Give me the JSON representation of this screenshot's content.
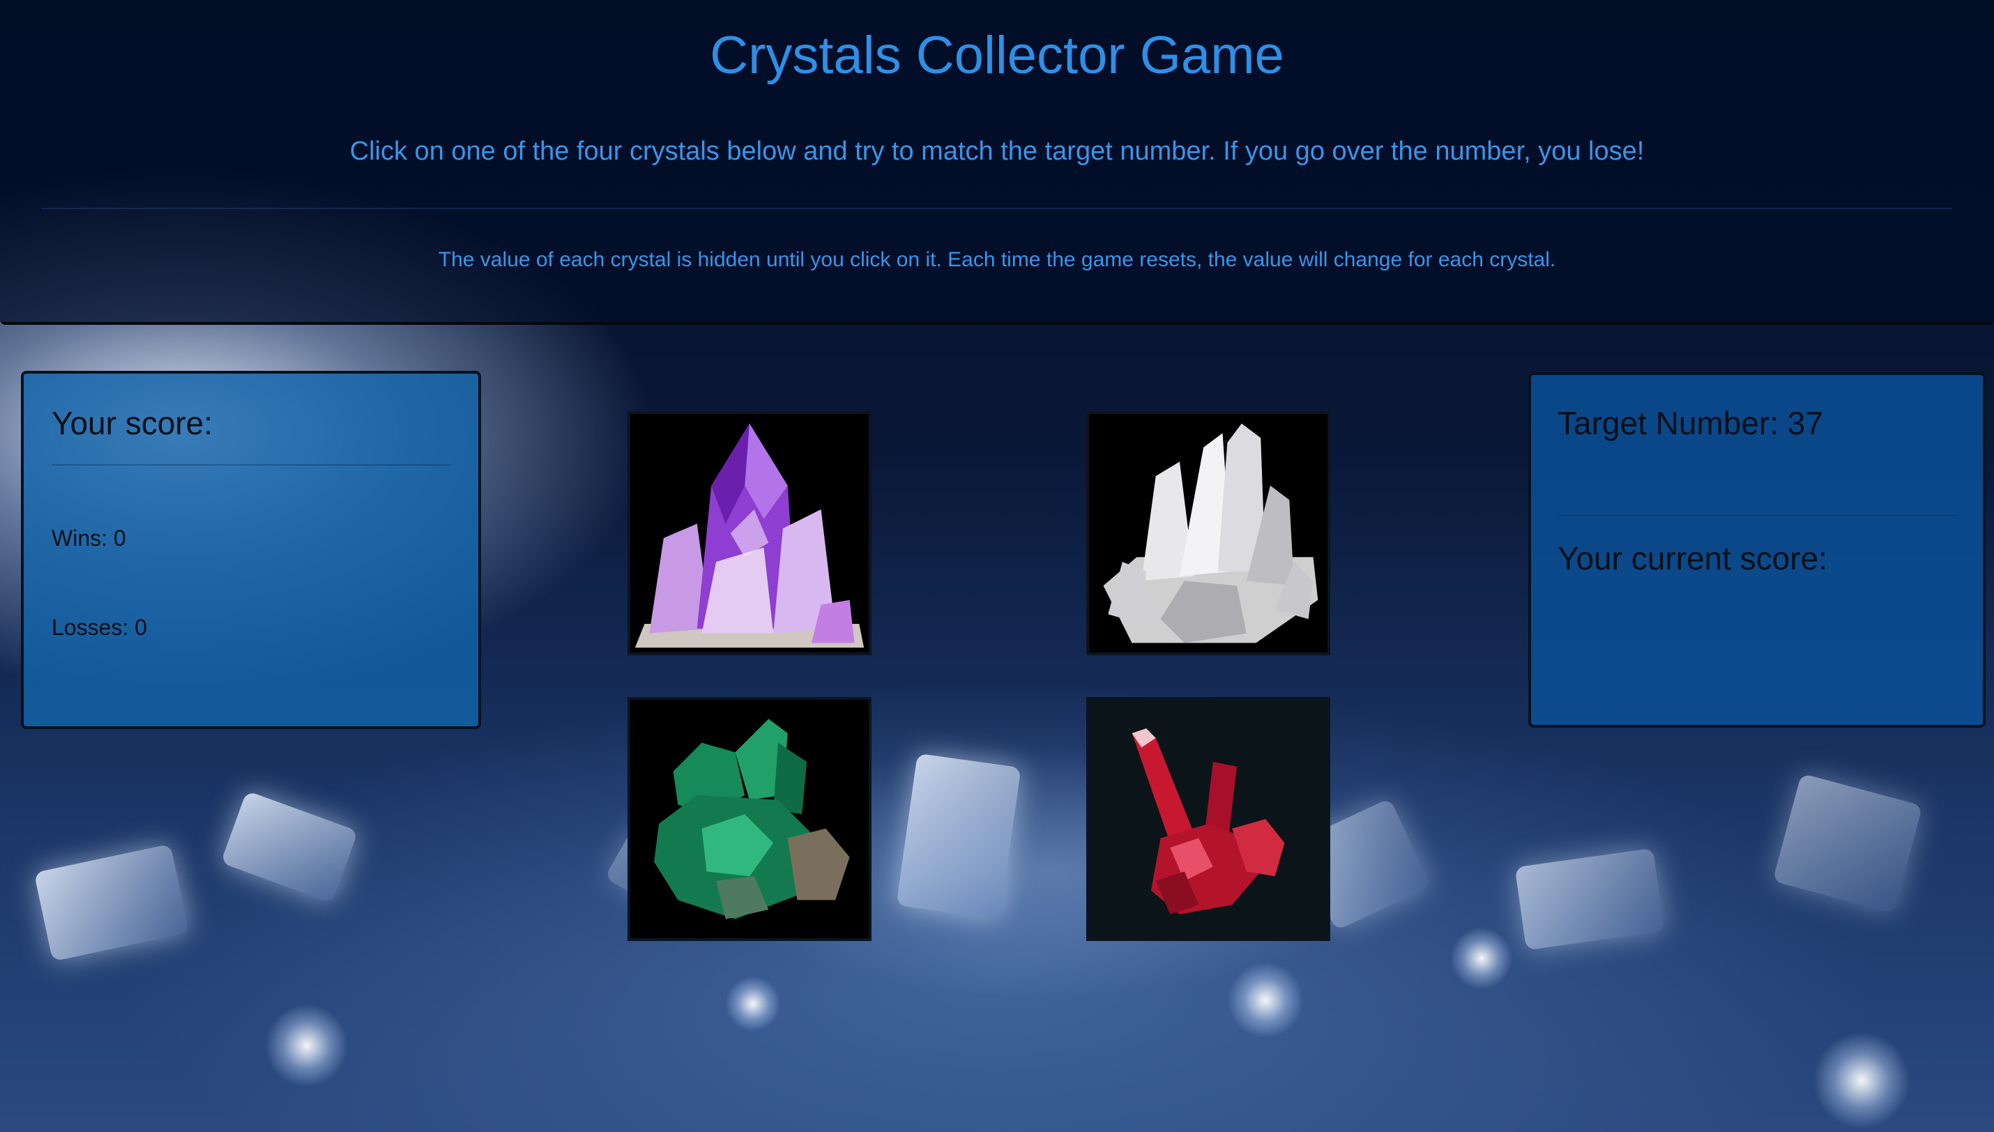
{
  "header": {
    "title": "Crystals Collector Game",
    "instructions": "Click on one of the four crystals below and try to match the target number. If you go over the number, you lose!",
    "note": "The value of each crystal is hidden until you click on it. Each time the game resets, the value will change for each crystal."
  },
  "score_panel": {
    "heading": "Your score:",
    "wins": "Wins: 0",
    "losses": "Losses: 0"
  },
  "target_panel": {
    "target": "Target Number: 37",
    "current_score_label": "Your current score:"
  },
  "crystals": [
    {
      "name": "amethyst",
      "icon": "purple-crystal-icon",
      "color": "#9b4fd6"
    },
    {
      "name": "quartz",
      "icon": "clear-crystal-icon",
      "color": "#e6e6ea"
    },
    {
      "name": "emerald",
      "icon": "green-crystal-icon",
      "color": "#1c8a5c"
    },
    {
      "name": "ruby",
      "icon": "red-crystal-icon",
      "color": "#b8142a"
    }
  ],
  "colors": {
    "accent": "#2e8fe6",
    "panel": "#1264aa"
  }
}
